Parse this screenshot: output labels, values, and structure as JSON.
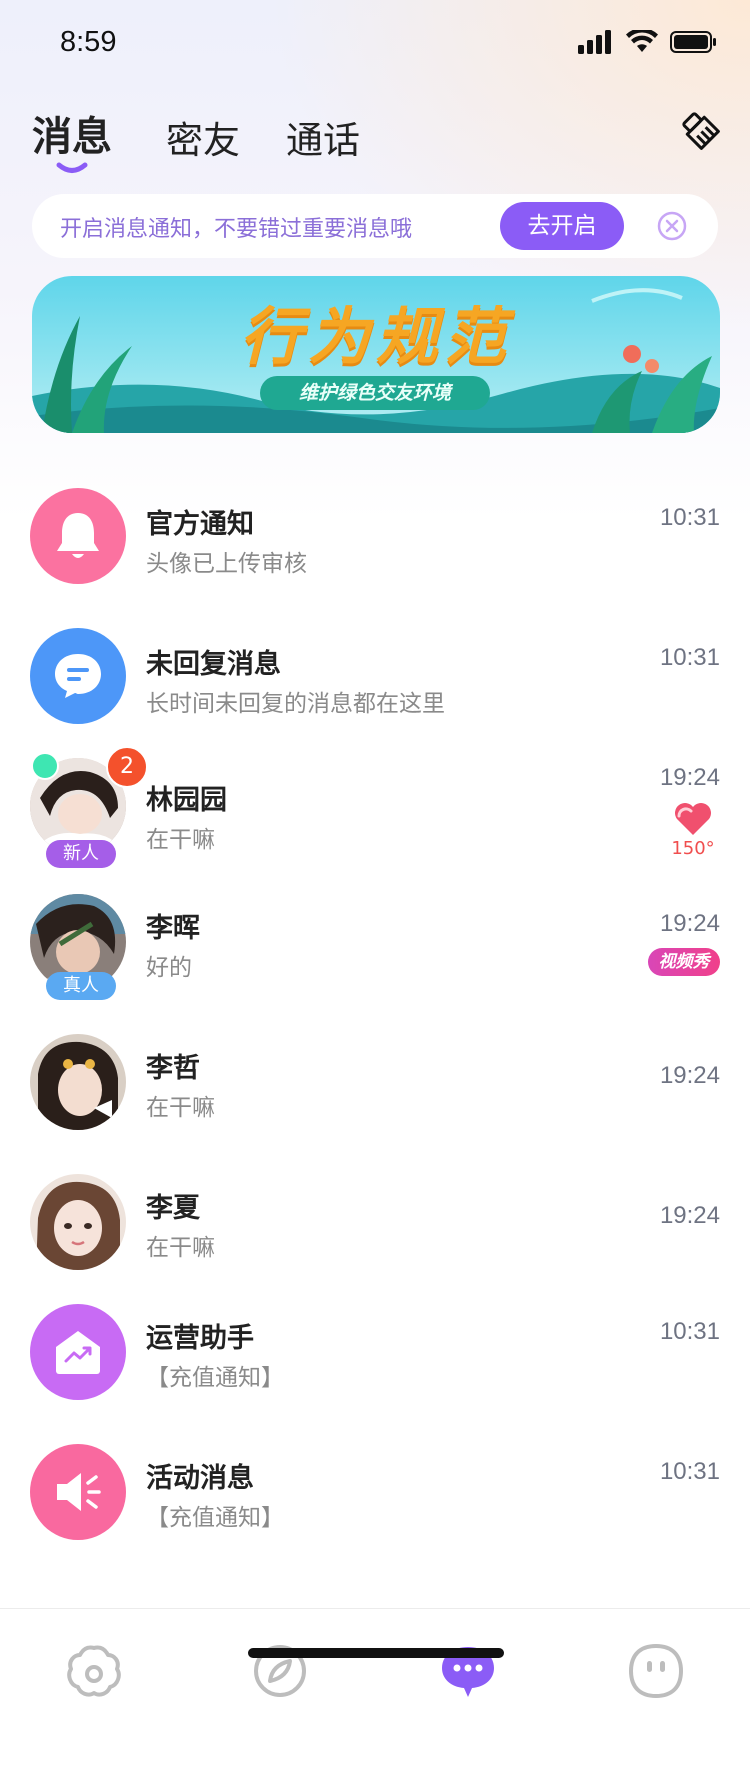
{
  "status_bar": {
    "time": "8:59"
  },
  "tabs": [
    {
      "label": "消息",
      "active": true
    },
    {
      "label": "密友",
      "active": false
    },
    {
      "label": "通话",
      "active": false
    }
  ],
  "notice": {
    "text": "开启消息通知，不要错过重要消息哦",
    "button_label": "去开启"
  },
  "banner": {
    "title": "行为规范",
    "subtitle": "维护绿色交友环境"
  },
  "conversations": [
    {
      "name": "官方通知",
      "preview": "头像已上传审核",
      "time": "10:31",
      "avatar_icon": "bell-icon",
      "avatar_color": "#fb72a0"
    },
    {
      "name": "未回复消息",
      "preview": "长时间未回复的消息都在这里",
      "time": "10:31",
      "avatar_icon": "chat-bubble-icon",
      "avatar_color": "#4d97f8"
    },
    {
      "name": "林园园",
      "preview": "在干嘛",
      "time": "19:24",
      "unread": "2",
      "tag": "新人",
      "tag_color": "#a55ee8",
      "online": true,
      "heart_value": "150°"
    },
    {
      "name": "李晖",
      "preview": "好的",
      "time": "19:24",
      "tag": "真人",
      "tag_color": "#5aa9f2",
      "badge": "视频秀"
    },
    {
      "name": "李哲",
      "preview": "在干嘛",
      "time": "19:24"
    },
    {
      "name": "李夏",
      "preview": "在干嘛",
      "time": "19:24"
    },
    {
      "name": "运营助手",
      "preview": "【充值通知】",
      "time": "10:31",
      "avatar_icon": "trend-envelope-icon",
      "avatar_color": "#c86bf4"
    },
    {
      "name": "活动消息",
      "preview": "【充值通知】",
      "time": "10:31",
      "avatar_icon": "megaphone-icon",
      "avatar_color": "#f9699f"
    }
  ],
  "bottom_nav": [
    {
      "icon": "home-flower-icon",
      "active": false
    },
    {
      "icon": "compass-icon",
      "active": false
    },
    {
      "icon": "messages-icon",
      "active": true
    },
    {
      "icon": "profile-face-icon",
      "active": false
    }
  ],
  "colors": {
    "accent": "#8b5cf6",
    "unread": "#f4512c",
    "online": "#3ee6b2"
  }
}
